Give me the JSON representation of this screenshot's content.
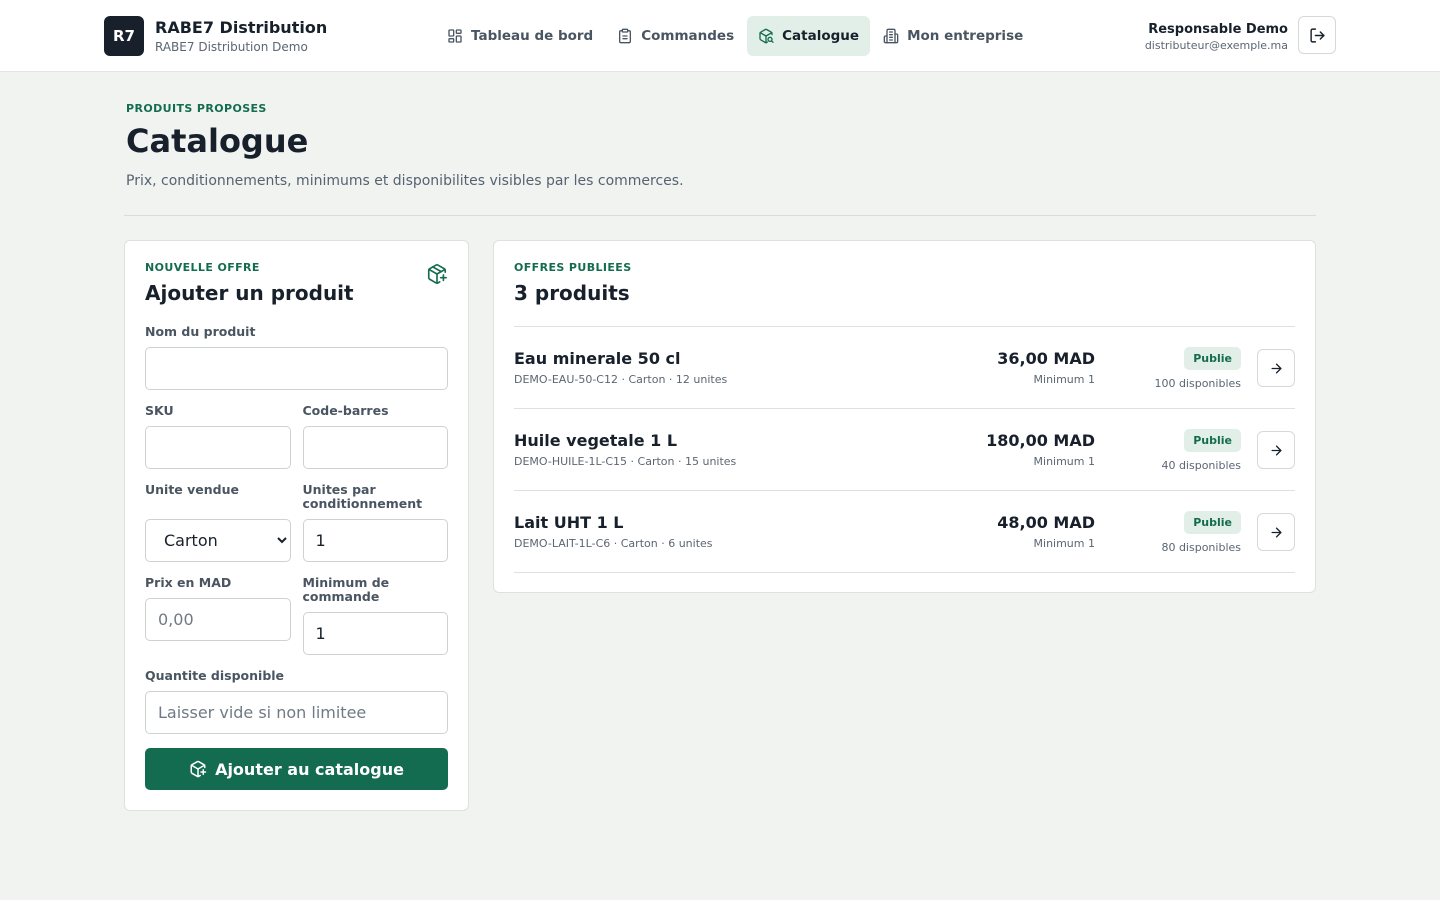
{
  "brand": {
    "logo": "R7",
    "title": "RABE7 Distribution",
    "subtitle": "RABE7 Distribution Demo"
  },
  "nav": {
    "items": [
      {
        "label": "Tableau de bord",
        "icon": "dashboard-icon"
      },
      {
        "label": "Commandes",
        "icon": "clipboard-icon"
      },
      {
        "label": "Catalogue",
        "icon": "package-search-icon",
        "active": true
      },
      {
        "label": "Mon entreprise",
        "icon": "building-icon"
      }
    ]
  },
  "user": {
    "name": "Responsable Demo",
    "email": "distributeur@exemple.ma"
  },
  "page": {
    "eyebrow": "PRODUITS PROPOSES",
    "title": "Catalogue",
    "description": "Prix, conditionnements, minimums et disponibilites visibles par les commerces."
  },
  "form": {
    "eyebrow": "NOUVELLE OFFRE",
    "title": "Ajouter un produit",
    "fields": {
      "name": {
        "label": "Nom du produit",
        "value": "",
        "placeholder": ""
      },
      "sku": {
        "label": "SKU",
        "value": "",
        "placeholder": ""
      },
      "barcode": {
        "label": "Code-barres",
        "value": "",
        "placeholder": ""
      },
      "unit": {
        "label": "Unite vendue",
        "selected": "Carton"
      },
      "units_per_pack": {
        "label": "Unites par conditionnement",
        "value": "1"
      },
      "price": {
        "label": "Prix en MAD",
        "value": "",
        "placeholder": "0,00"
      },
      "min_order": {
        "label": "Minimum de commande",
        "value": "1"
      },
      "quantity": {
        "label": "Quantite disponible",
        "value": "",
        "placeholder": "Laisser vide si non limitee"
      }
    },
    "submit_label": "Ajouter au catalogue"
  },
  "offers": {
    "eyebrow": "OFFRES PUBLIEES",
    "title": "3 produits",
    "items": [
      {
        "name": "Eau minerale 50 cl",
        "meta": "DEMO-EAU-50-C12 · Carton · 12 unites",
        "price": "36,00 MAD",
        "minimum": "Minimum 1",
        "status": "Publie",
        "stock": "100 disponibles"
      },
      {
        "name": "Huile vegetale 1 L",
        "meta": "DEMO-HUILE-1L-C15 · Carton · 15 unites",
        "price": "180,00 MAD",
        "minimum": "Minimum 1",
        "status": "Publie",
        "stock": "40 disponibles"
      },
      {
        "name": "Lait UHT 1 L",
        "meta": "DEMO-LAIT-1L-C6 · Carton · 6 unites",
        "price": "48,00 MAD",
        "minimum": "Minimum 1",
        "status": "Publie",
        "stock": "80 disponibles"
      }
    ]
  },
  "colors": {
    "accent": "#146c50",
    "accent_soft": "#e2efe8",
    "text": "#17202b",
    "background": "#f1f3f1"
  }
}
